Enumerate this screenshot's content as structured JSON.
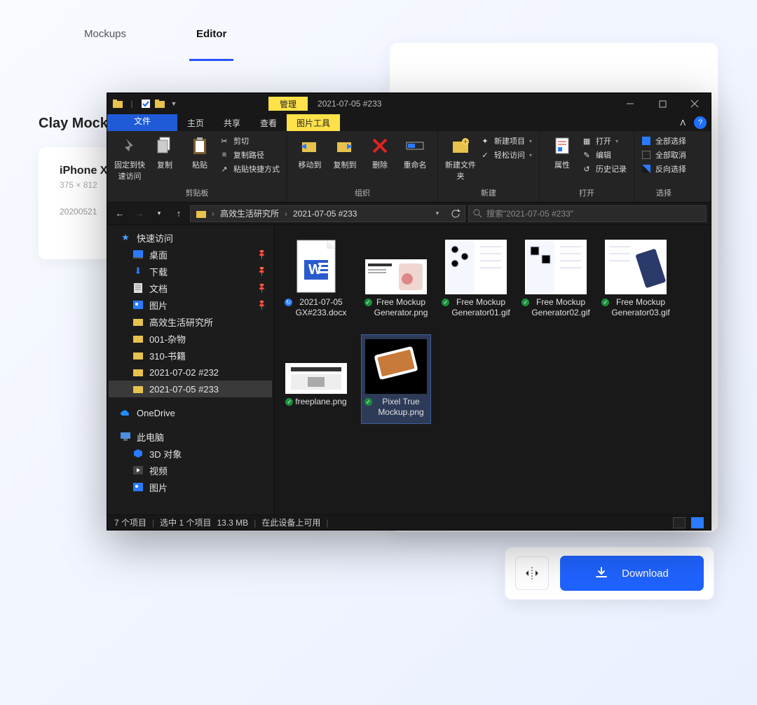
{
  "web": {
    "tabs": {
      "mockups": "Mockups",
      "editor": "Editor"
    },
    "heading": "Clay Mockups",
    "card": {
      "title": "iPhone X",
      "sub": "375 × 812",
      "date": "20200521"
    },
    "download": "Download"
  },
  "explorer": {
    "title": "2021-07-05 #233",
    "contextTab": "管理",
    "menu": {
      "file": "文件",
      "home": "主页",
      "share": "共享",
      "view": "查看",
      "pictools": "图片工具"
    },
    "ribbon": {
      "clipboard": {
        "label": "剪贴板",
        "pin": "固定到快速访问",
        "copy": "复制",
        "paste": "粘贴",
        "cut": "剪切",
        "copypath": "复制路径",
        "pasteshortcut": "粘贴快捷方式"
      },
      "organize": {
        "label": "组织",
        "moveto": "移动到",
        "copyto": "复制到",
        "delete": "删除",
        "rename": "重命名"
      },
      "new": {
        "label": "新建",
        "newfolder": "新建文件夹",
        "newitem": "新建项目",
        "easyaccess": "轻松访问"
      },
      "open": {
        "label": "打开",
        "properties": "属性",
        "open": "打开",
        "edit": "编辑",
        "history": "历史记录"
      },
      "select": {
        "label": "选择",
        "selectall": "全部选择",
        "selectnone": "全部取消",
        "invert": "反向选择"
      }
    },
    "breadcrumb": {
      "root_icon": "folder",
      "parts": [
        "高效生活研究所",
        "2021-07-05 #233"
      ]
    },
    "search_placeholder": "搜索\"2021-07-05 #233\"",
    "sidenav": {
      "quick": "快速访问",
      "desktop": "桌面",
      "downloads": "下载",
      "documents": "文档",
      "pictures": "图片",
      "custom1": "高效生活研究所",
      "custom2": "001-杂物",
      "custom3": "310-书籍",
      "custom4": "2021-07-02 #232",
      "custom5": "2021-07-05 #233",
      "onedrive": "OneDrive",
      "thispc": "此电脑",
      "obj3d": "3D 对象",
      "videos": "视频",
      "pics2": "图片"
    },
    "files": [
      {
        "name": "2021-07-05 GX#233.docx",
        "type": "docx",
        "sync": "refresh"
      },
      {
        "name": "Free Mockup Generator.png",
        "type": "png",
        "sync": "ok"
      },
      {
        "name": "Free Mockup Generator01.gif",
        "type": "gif",
        "sync": "ok"
      },
      {
        "name": "Free Mockup Generator02.gif",
        "type": "gif",
        "sync": "ok"
      },
      {
        "name": "Free Mockup Generator03.gif",
        "type": "gif",
        "sync": "ok"
      },
      {
        "name": "freeplane.png",
        "type": "png",
        "sync": "ok"
      },
      {
        "name": "Pixel True Mockup.png",
        "type": "png-dark",
        "sync": "ok",
        "selected": true
      }
    ],
    "status": {
      "items": "7 个项目",
      "selected": "选中 1 个项目",
      "size": "13.3 MB",
      "available": "在此设备上可用"
    }
  }
}
